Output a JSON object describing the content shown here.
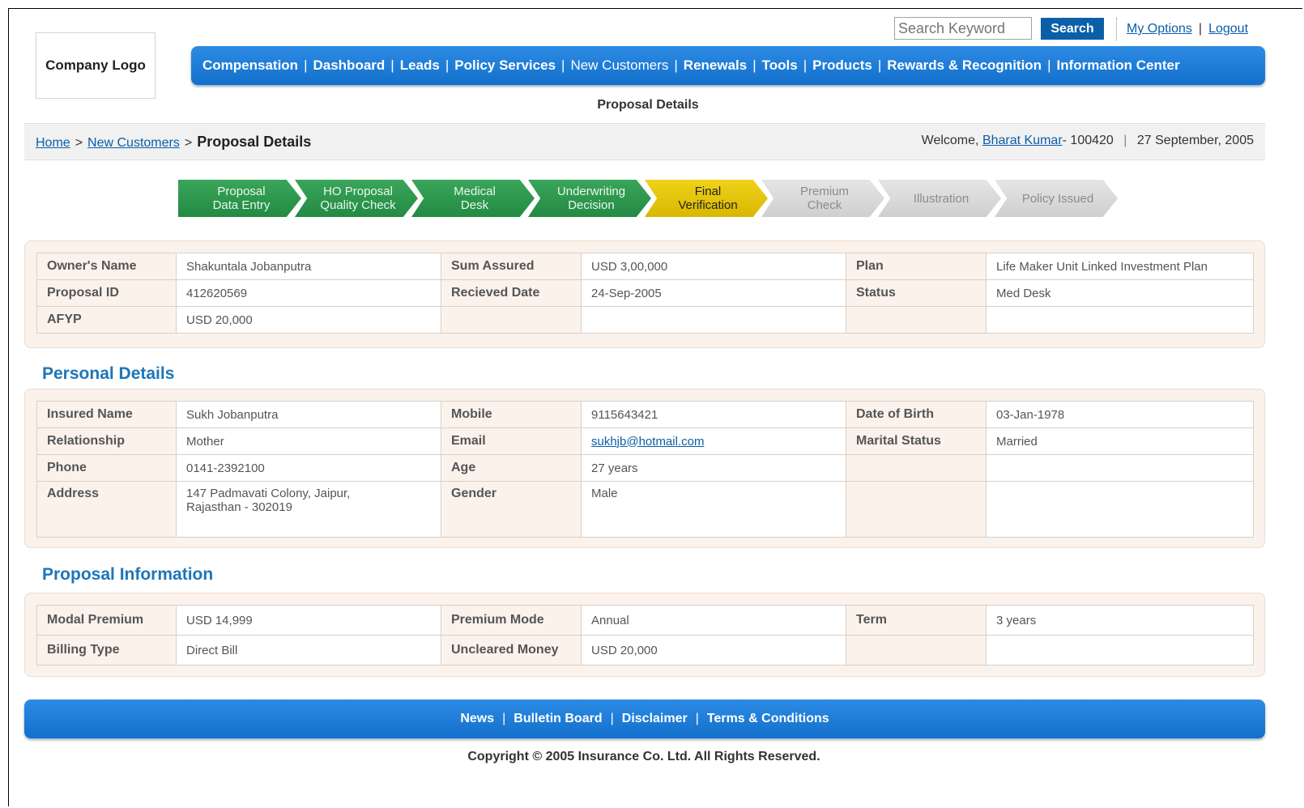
{
  "logo": "Company Logo",
  "search": {
    "placeholder": "Search Keyword",
    "button": "Search"
  },
  "top_links": [
    "My Options",
    "Logout"
  ],
  "top_links_separator": "|",
  "nav": {
    "items": [
      "Compensation",
      "Dashboard",
      "Leads",
      "Policy Services",
      "New Customers",
      "Renewals",
      "Tools",
      "Products",
      "Rewards & Recognition",
      "Information Center"
    ],
    "active": "New Customers",
    "separator": "|"
  },
  "page_heading": "Proposal Details",
  "breadcrumb": {
    "home": "Home",
    "section": "New Customers",
    "current": "Proposal Details",
    "sep": ">"
  },
  "welcome": {
    "prefix": "Welcome,",
    "user": "Bharat Kumar",
    "user_id": "- 100420",
    "date": "27 September, 2005",
    "sep": "|"
  },
  "steps": [
    {
      "line1": "Proposal",
      "line2": "Data Entry",
      "state": "done"
    },
    {
      "line1": "HO Proposal",
      "line2": "Quality Check",
      "state": "done"
    },
    {
      "line1": "Medical",
      "line2": "Desk",
      "state": "done"
    },
    {
      "line1": "Underwriting",
      "line2": "Decision",
      "state": "done"
    },
    {
      "line1": "Final",
      "line2": "Verification",
      "state": "current"
    },
    {
      "line1": "Premium",
      "line2": "Check",
      "state": "pending"
    },
    {
      "line1": "Illustration",
      "line2": "",
      "state": "pending"
    },
    {
      "line1": "Policy Issued",
      "line2": "",
      "state": "pending"
    }
  ],
  "summary": [
    [
      {
        "label": "Owner's Name",
        "value": "Shakuntala Jobanputra"
      },
      {
        "label": "Sum Assured",
        "value": "USD  3,00,000"
      },
      {
        "label": "Plan",
        "value": "Life Maker Unit Linked Investment Plan"
      }
    ],
    [
      {
        "label": "Proposal ID",
        "value": "412620569"
      },
      {
        "label": "Recieved Date",
        "value": "24-Sep-2005"
      },
      {
        "label": "Status",
        "value": "Med Desk"
      }
    ],
    [
      {
        "label": "AFYP",
        "value": "USD  20,000"
      },
      {
        "label": "",
        "value": ""
      },
      {
        "label": "",
        "value": ""
      }
    ]
  ],
  "personal": {
    "title": "Personal Details",
    "rows": [
      [
        {
          "label": "Insured Name",
          "value": "Sukh Jobanputra"
        },
        {
          "label": "Mobile",
          "value": "9115643421"
        },
        {
          "label": "Date of Birth",
          "value": "03-Jan-1978"
        }
      ],
      [
        {
          "label": "Relationship",
          "value": "Mother"
        },
        {
          "label": "Email",
          "value": "sukhjb@hotmail.com",
          "link": true
        },
        {
          "label": "Marital Status",
          "value": "Married"
        }
      ],
      [
        {
          "label": "Phone",
          "value": "0141-2392100"
        },
        {
          "label": "Age",
          "value": "27 years"
        },
        {
          "label": "",
          "value": ""
        }
      ],
      [
        {
          "label": "Address",
          "value": "147 Padmavati Colony, Jaipur,\nRajasthan - 302019"
        },
        {
          "label": "Gender",
          "value": "Male"
        },
        {
          "label": "",
          "value": ""
        }
      ]
    ]
  },
  "proposal": {
    "title": "Proposal Information",
    "rows": [
      [
        {
          "label": "Modal Premium",
          "value": "USD  14,999"
        },
        {
          "label": "Premium Mode",
          "value": "Annual"
        },
        {
          "label": "Term",
          "value": "3 years"
        }
      ],
      [
        {
          "label": "Billing Type",
          "value": "Direct Bill"
        },
        {
          "label": "Uncleared Money",
          "value": "USD  20,000"
        },
        {
          "label": "",
          "value": ""
        }
      ]
    ]
  },
  "footer": {
    "links": [
      "News",
      "Bulletin Board",
      "Disclaimer",
      "Terms & Conditions"
    ],
    "separator": "|",
    "copyright": "Copyright © 2005 Insurance Co. Ltd. All Rights Reserved."
  },
  "colors": {
    "nav_blue": "#1b7ad6",
    "link": "#0b5fa8",
    "section_title": "#1d76b8",
    "step_done": "#2e9a4e",
    "step_current": "#e8c80c",
    "step_pending": "#d8d8d8",
    "label_bg": "#fbf2ec"
  }
}
